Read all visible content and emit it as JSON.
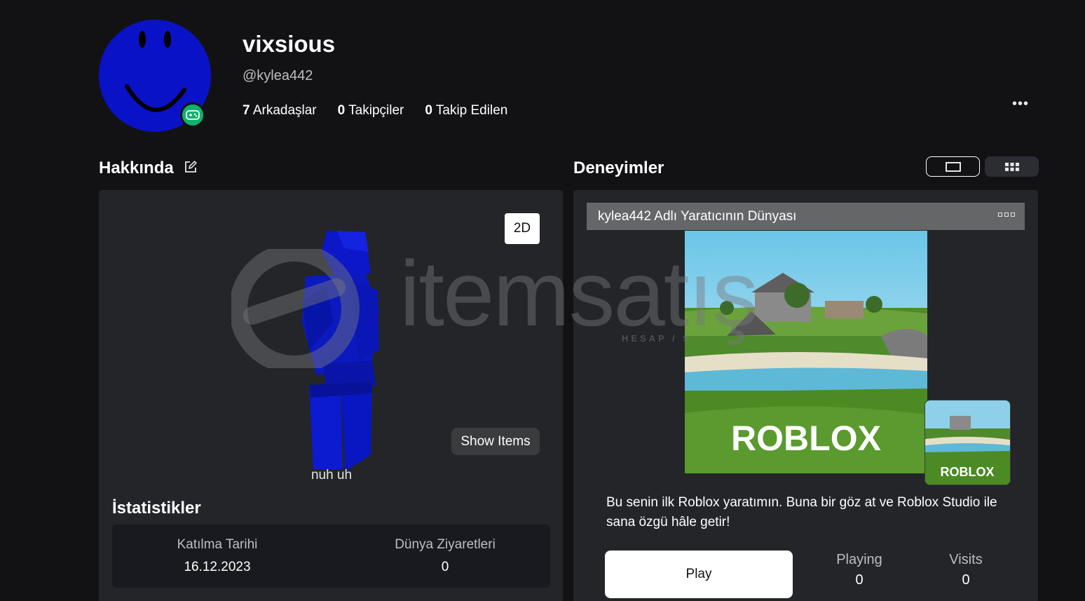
{
  "profile": {
    "display_name": "vixsious",
    "handle": "@kylea442",
    "friends": {
      "count": "7",
      "label": "Arkadaşlar"
    },
    "followers": {
      "count": "0",
      "label": "Takipçiler"
    },
    "following": {
      "count": "0",
      "label": "Takip Edilen"
    },
    "more_label": "•••"
  },
  "about": {
    "title": "Hakkında",
    "btn_2d": "2D",
    "show_items": "Show Items",
    "caption": "nuh uh"
  },
  "statistics": {
    "title": "İstatistikler",
    "join_date_label": "Katılma Tarihi",
    "join_date_value": "16.12.2023",
    "visits_label": "Dünya Ziyaretleri",
    "visits_value": "0"
  },
  "experiences": {
    "title": "Deneyimler",
    "item": {
      "name": "kylea442 Adlı Yaratıcının Dünyası",
      "thumb_logo": "ROBLOX",
      "description": "Bu senin ilk Roblox yaratımın. Buna bir göz at ve Roblox Studio ile sana özgü hâle getir!",
      "play_label": "Play",
      "playing_label": "Playing",
      "playing_value": "0",
      "visits_label": "Visits",
      "visits_value": "0"
    }
  },
  "watermark": {
    "text": "itemsatış",
    "sub": "HESAP / S"
  },
  "colors": {
    "background": "#121215",
    "panel": "#232529",
    "avatar_blue": "#0a12c8",
    "presence_green": "#0fb26b"
  }
}
